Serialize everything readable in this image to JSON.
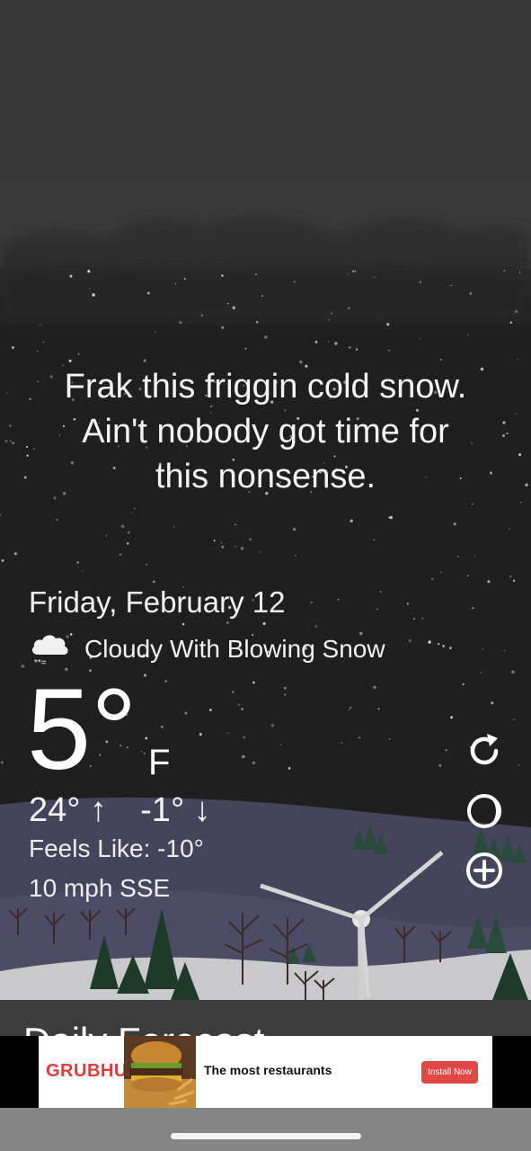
{
  "quote": {
    "line1": "Frak this friggin cold snow.",
    "line2": "Ain't nobody got time for",
    "line3": "this nonsense."
  },
  "weather": {
    "date": "Friday, February 12",
    "condition": "Cloudy With Blowing Snow",
    "condition_icon": "cloud-snow-icon",
    "temperature": "5°",
    "unit": "F",
    "high": "24°",
    "low": "-1°",
    "feels_like": "Feels Like: -10°",
    "wind": "10 mph SSE"
  },
  "actions": {
    "refresh_icon": "refresh-icon",
    "theme_icon": "moon-phase-icon",
    "add_icon": "add-circle-icon"
  },
  "forecast": {
    "title": "Daily Forecast"
  },
  "ad": {
    "brand": "GRUBHUB",
    "headline": "The most restaurants",
    "cta": "Install Now",
    "image": "burger-fries-image"
  },
  "colors": {
    "sky_top": "#3a3a3a",
    "night": "#1e1e1e",
    "ground": "#464660",
    "snow": "#c8c8cc",
    "ad_accent": "#e04848"
  }
}
